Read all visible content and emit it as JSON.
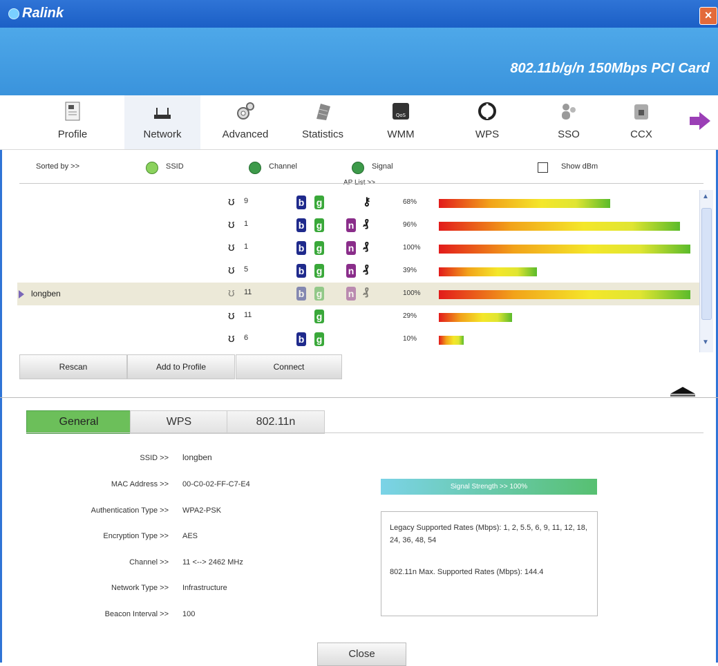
{
  "window": {
    "title": "Ralink",
    "product": "802.11b/g/n  150Mbps  PCI  Card"
  },
  "toolbar": {
    "items": [
      {
        "label": "Profile"
      },
      {
        "label": "Network"
      },
      {
        "label": "Advanced"
      },
      {
        "label": "Statistics"
      },
      {
        "label": "WMM"
      },
      {
        "label": "WPS"
      },
      {
        "label": "SSO"
      },
      {
        "label": "CCX"
      }
    ]
  },
  "sort": {
    "sorted_by": "Sorted by >>",
    "ssid": "SSID",
    "channel": "Channel",
    "signal": "Signal",
    "ap_list": "AP List >>",
    "show_dbm": "Show dBm"
  },
  "ap_list": [
    {
      "ssid": "",
      "channel": "9",
      "b": true,
      "g": true,
      "n": false,
      "secure": "key",
      "signal": "68%",
      "signal_value": 68
    },
    {
      "ssid": "",
      "channel": "1",
      "b": true,
      "g": true,
      "n": true,
      "secure": "wps",
      "signal": "96%",
      "signal_value": 96
    },
    {
      "ssid": "",
      "channel": "1",
      "b": true,
      "g": true,
      "n": true,
      "secure": "wps",
      "signal": "100%",
      "signal_value": 100
    },
    {
      "ssid": "",
      "channel": "5",
      "b": true,
      "g": true,
      "n": true,
      "secure": "wps",
      "signal": "39%",
      "signal_value": 39
    },
    {
      "ssid": "longben",
      "channel": "11",
      "b": true,
      "g": true,
      "n": true,
      "secure": "wps",
      "signal": "100%",
      "signal_value": 100,
      "selected": true
    },
    {
      "ssid": "",
      "channel": "11",
      "b": false,
      "g": true,
      "n": false,
      "secure": "",
      "signal": "29%",
      "signal_value": 29
    },
    {
      "ssid": "",
      "channel": "6",
      "b": true,
      "g": true,
      "n": false,
      "secure": "",
      "signal": "10%",
      "signal_value": 10
    }
  ],
  "buttons": {
    "rescan": "Rescan",
    "add_to_profile": "Add to Profile",
    "connect": "Connect",
    "close": "Close"
  },
  "tabs": {
    "general": "General",
    "wps": "WPS",
    "n": "802.11n"
  },
  "details": {
    "ssid_label": "SSID >>",
    "ssid": "longben",
    "mac_label": "MAC Address >>",
    "mac": "00-C0-02-FF-C7-E4",
    "auth_label": "Authentication Type >>",
    "auth": "WPA2-PSK",
    "enc_label": "Encryption Type >>",
    "enc": "AES",
    "channel_label": "Channel >>",
    "channel": "11 <--> 2462 MHz",
    "nettype_label": "Network Type >>",
    "nettype": "Infrastructure",
    "beacon_label": "Beacon Interval >>",
    "beacon": "100"
  },
  "signal_strength": {
    "text": "Signal Strength >> 100%",
    "value": 100
  },
  "rates": {
    "legacy": "Legacy Supported Rates (Mbps): 1, 2, 5.5, 6, 9, 11, 12, 18, 24, 36, 48, 54",
    "max": "802.11n Max. Supported Rates (Mbps): 144.4"
  },
  "colors": {
    "titlebar": "#1b5fc6",
    "banner": "#4ea8e9",
    "accent": "#6cbf5a"
  }
}
